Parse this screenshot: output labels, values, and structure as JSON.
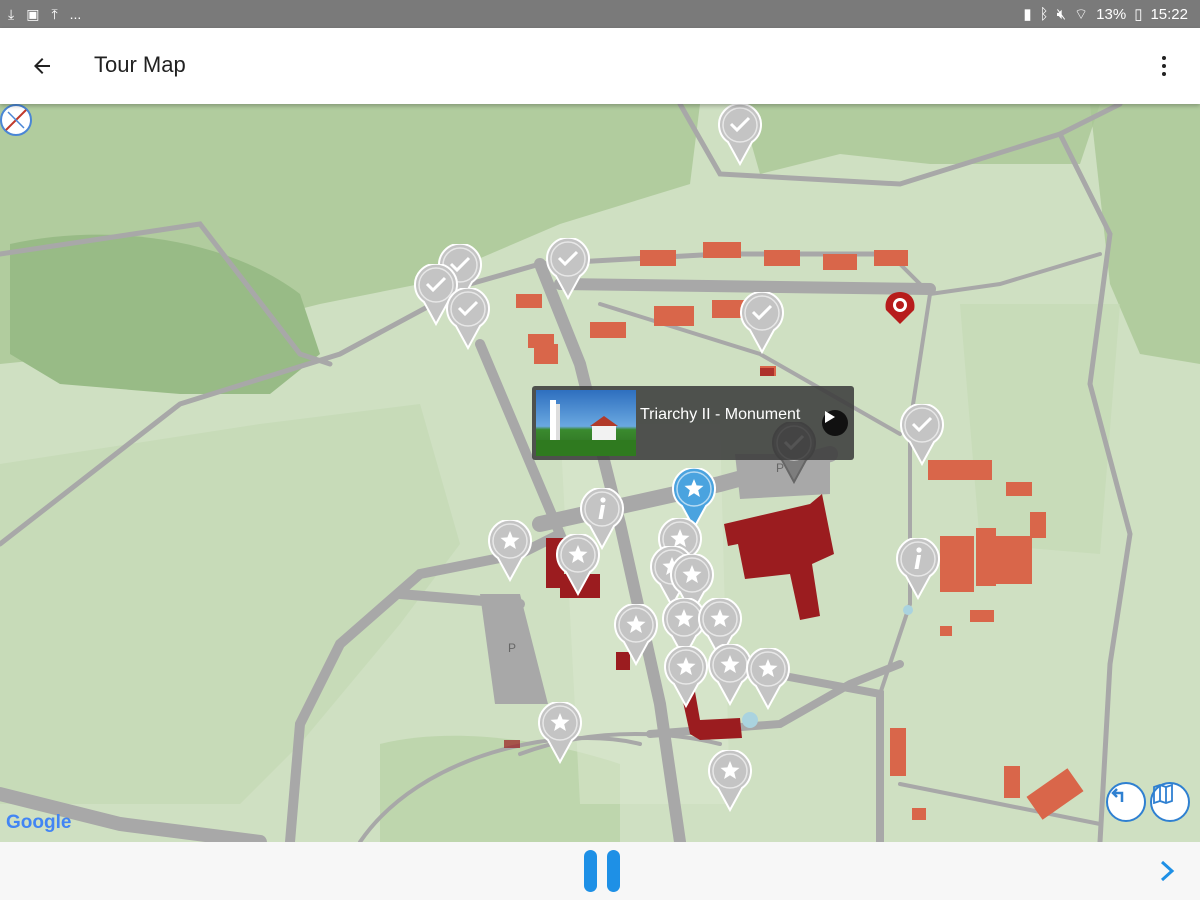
{
  "status_bar": {
    "left_icons": [
      "download-icon",
      "image-icon",
      "upload-icon"
    ],
    "left_more": "...",
    "battery_percent": "13%",
    "time": "15:22",
    "right_icons": [
      "battery-saver-icon",
      "bluetooth-icon",
      "mute-icon",
      "wifi-icon",
      "battery-icon"
    ]
  },
  "app_bar": {
    "title": "Tour Map"
  },
  "popup": {
    "title": "Triarchy II - Monument"
  },
  "map_labels": {
    "parking_1": "P",
    "parking_2": "P",
    "google": "Google"
  },
  "colors": {
    "accent": "#1e90e6",
    "active_pin": "#4aa3df",
    "pin_gray": "#bdbdbd",
    "building_red": "#d9664a",
    "building_dark": "#9b1c1f",
    "map_green": "#cfe0c2",
    "forest_green": "#a9c795",
    "road_gray": "#a3a3a3"
  },
  "pins": [
    {
      "icon": "check-icon",
      "state": "visited"
    },
    {
      "icon": "check-icon",
      "state": "visited"
    },
    {
      "icon": "check-icon",
      "state": "visited"
    },
    {
      "icon": "check-icon",
      "state": "visited"
    },
    {
      "icon": "check-icon",
      "state": "visited"
    },
    {
      "icon": "check-icon",
      "state": "visited"
    },
    {
      "icon": "check-icon",
      "state": "visited"
    },
    {
      "icon": "check-icon",
      "state": "visited-dark"
    },
    {
      "icon": "star-icon",
      "state": "active"
    },
    {
      "icon": "info-icon",
      "state": "info"
    },
    {
      "icon": "star-icon",
      "state": "unvisited"
    },
    {
      "icon": "star-icon",
      "state": "unvisited"
    },
    {
      "icon": "star-icon",
      "state": "unvisited"
    },
    {
      "icon": "star-icon",
      "state": "unvisited"
    },
    {
      "icon": "star-icon",
      "state": "unvisited"
    },
    {
      "icon": "star-icon",
      "state": "unvisited"
    },
    {
      "icon": "star-icon",
      "state": "unvisited"
    },
    {
      "icon": "star-icon",
      "state": "unvisited"
    },
    {
      "icon": "star-icon",
      "state": "unvisited"
    },
    {
      "icon": "star-icon",
      "state": "unvisited"
    },
    {
      "icon": "star-icon",
      "state": "unvisited"
    },
    {
      "icon": "info-icon",
      "state": "info"
    },
    {
      "icon": "star-icon",
      "state": "unvisited"
    },
    {
      "icon": "star-icon",
      "state": "unvisited"
    },
    {
      "icon": "star-icon",
      "state": "unvisited"
    },
    {
      "icon": "star-icon",
      "state": "unvisited"
    }
  ]
}
